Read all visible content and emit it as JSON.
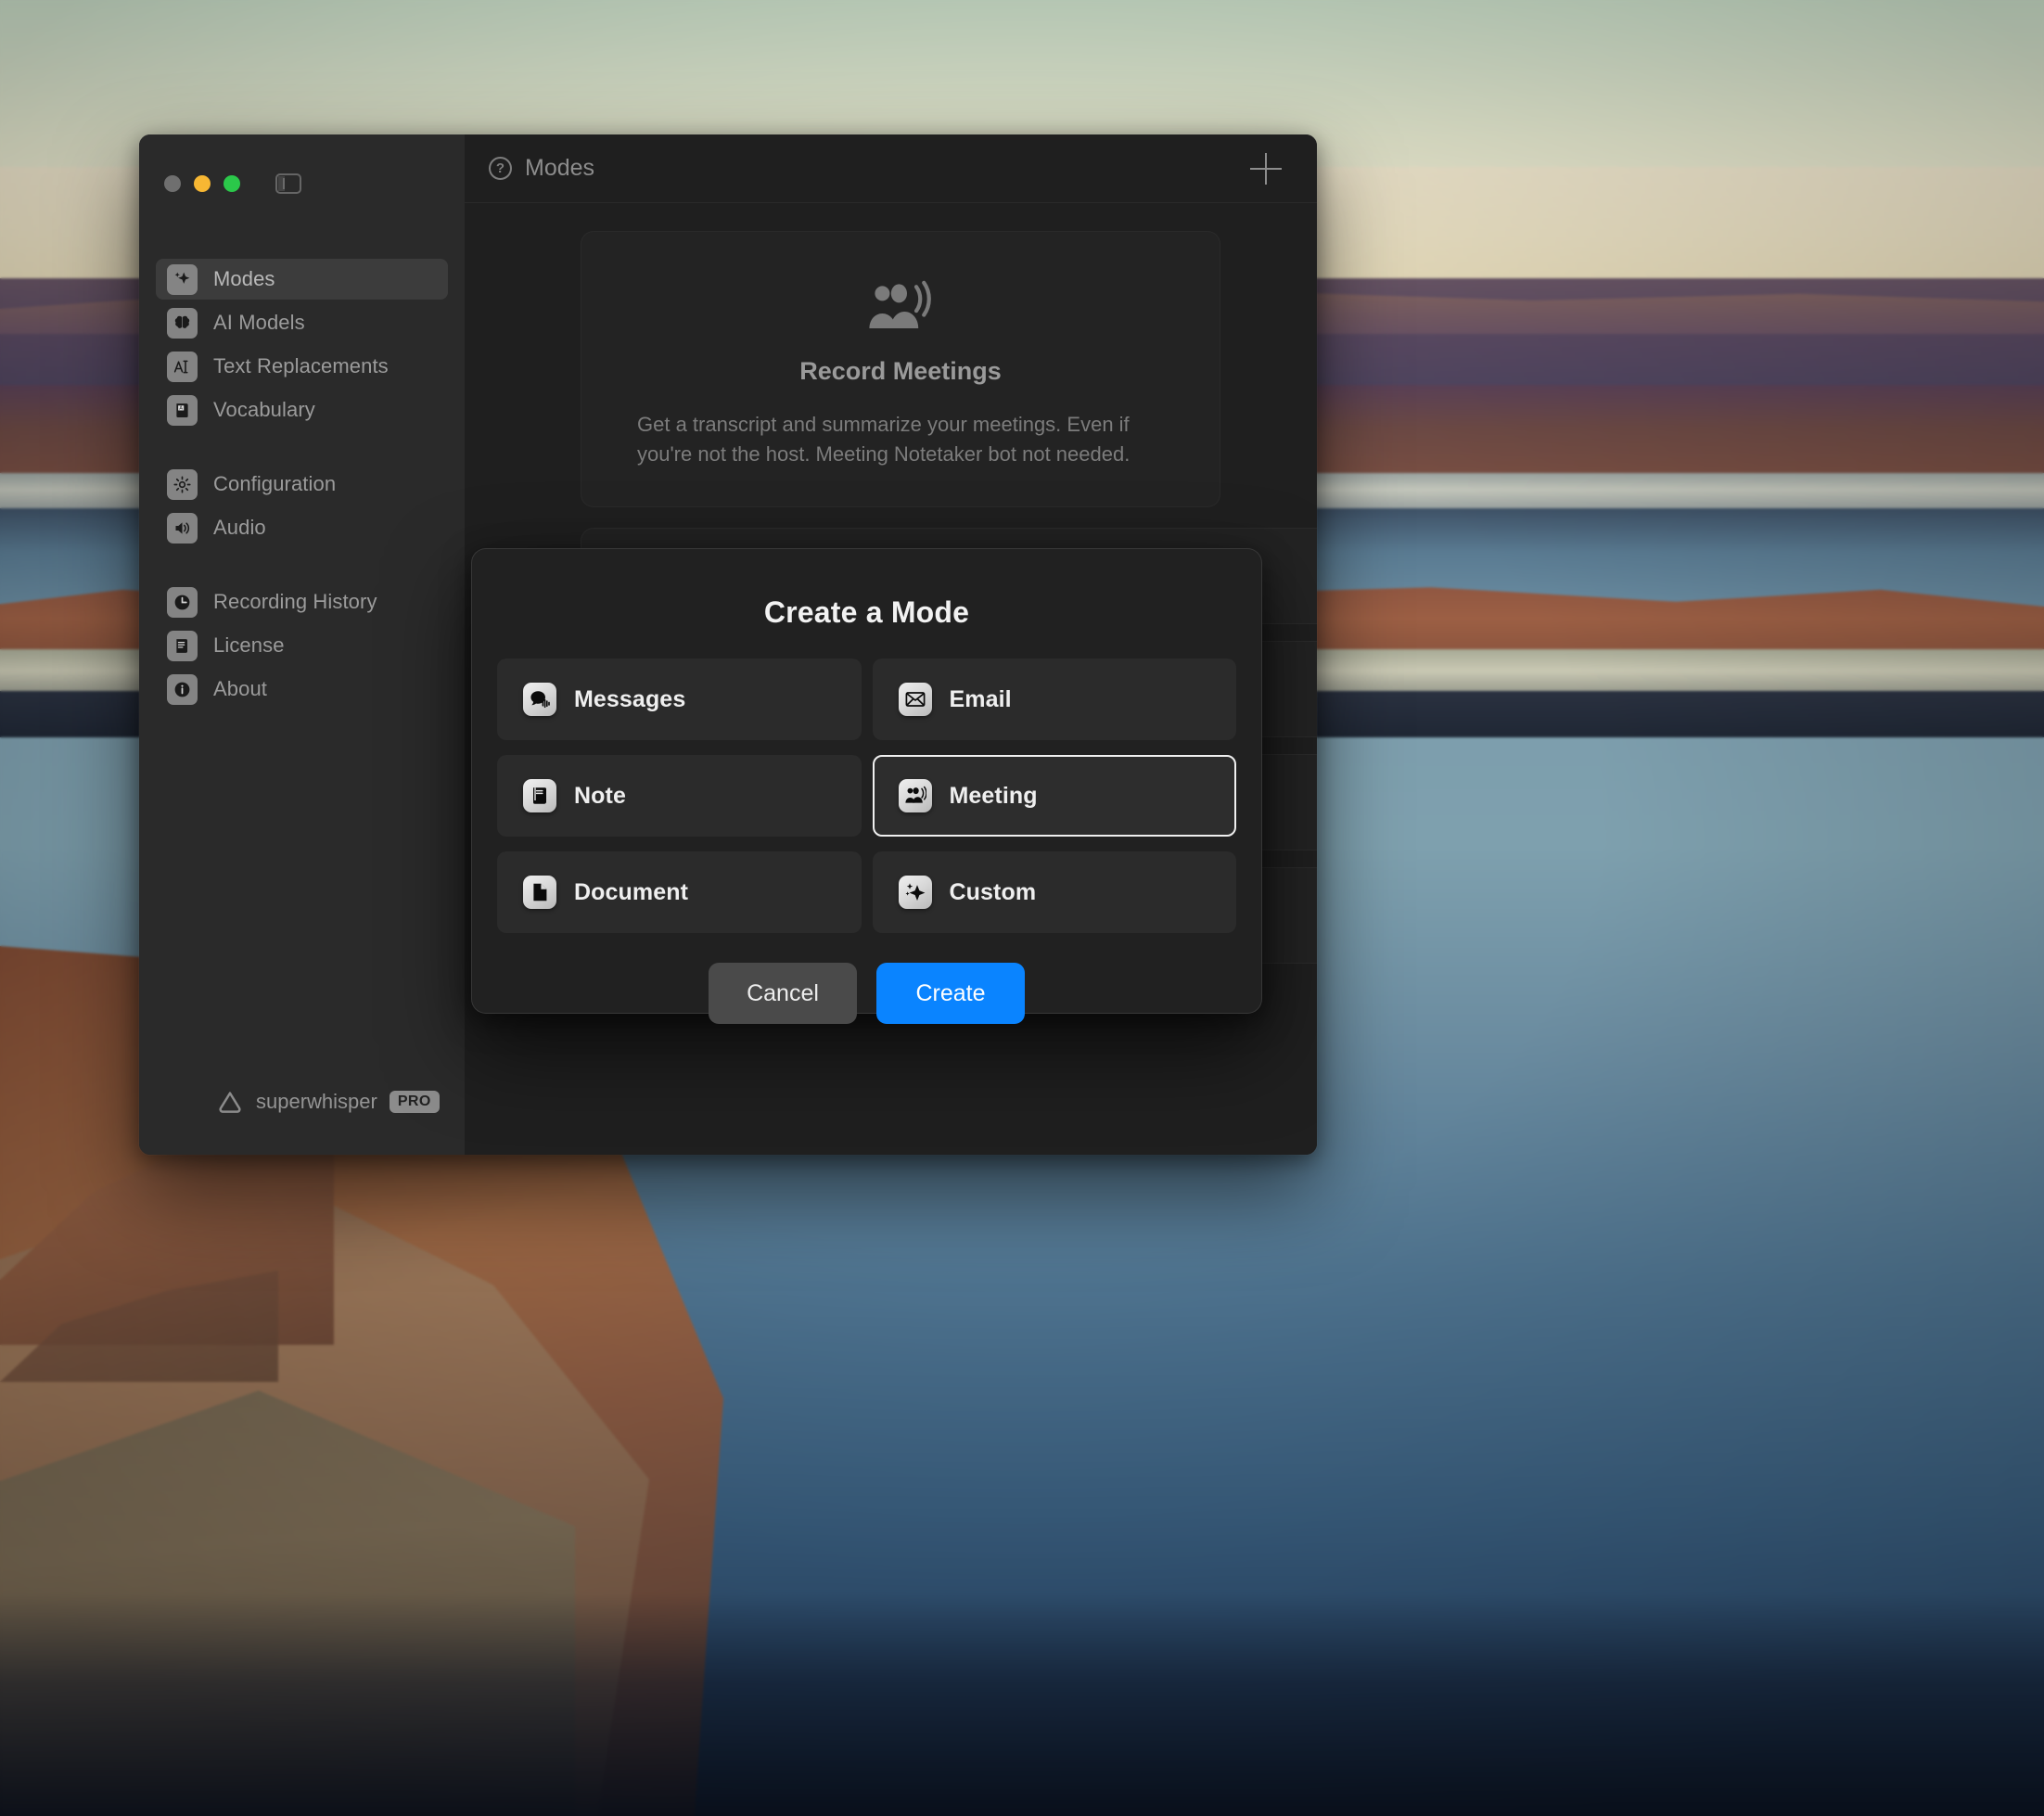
{
  "window": {
    "traffic_lights": [
      "close",
      "minimize",
      "zoom"
    ],
    "sidebar_toggle_icon": "sidebar-toggle-icon"
  },
  "sidebar": {
    "groups": [
      {
        "items": [
          {
            "label": "Modes",
            "icon": "sparkles-icon",
            "active": true
          },
          {
            "label": "AI Models",
            "icon": "brain-icon",
            "active": false
          },
          {
            "label": "Text Replacements",
            "icon": "text-cursor-icon",
            "active": false
          },
          {
            "label": "Vocabulary",
            "icon": "book-icon",
            "active": false
          }
        ]
      },
      {
        "items": [
          {
            "label": "Configuration",
            "icon": "gear-icon",
            "active": false
          },
          {
            "label": "Audio",
            "icon": "speaker-icon",
            "active": false
          }
        ]
      },
      {
        "items": [
          {
            "label": "Recording History",
            "icon": "clock-icon",
            "active": false
          },
          {
            "label": "License",
            "icon": "document-lines-icon",
            "active": false
          },
          {
            "label": "About",
            "icon": "info-icon",
            "active": false
          }
        ]
      }
    ],
    "footer": {
      "app_name": "superwhisper",
      "badge": "PRO",
      "logo_icon": "superwhisper-triangle-icon"
    }
  },
  "header": {
    "help_icon": "question-mark-icon",
    "title": "Modes",
    "add_icon": "plus-icon"
  },
  "main": {
    "promo": {
      "icon": "people-speaking-icon",
      "title": "Record Meetings",
      "description": "Get a transcript and summarize your meetings. Even if you're not the host. Meeting Notetaker bot not needed."
    },
    "mode_rows": [
      {
        "chevron": "chevron-right-icon"
      },
      {
        "chevron": "chevron-right-icon"
      },
      {
        "chevron": "chevron-right-icon"
      },
      {
        "chevron": "chevron-right-icon"
      }
    ]
  },
  "modal": {
    "title": "Create a Mode",
    "options": [
      {
        "label": "Messages",
        "icon": "speech-bubble-waveform-icon",
        "selected": false
      },
      {
        "label": "Email",
        "icon": "envelope-icon",
        "selected": false
      },
      {
        "label": "Note",
        "icon": "notebook-icon",
        "selected": false
      },
      {
        "label": "Meeting",
        "icon": "people-speaking-icon",
        "selected": true
      },
      {
        "label": "Document",
        "icon": "page-icon",
        "selected": false
      },
      {
        "label": "Custom",
        "icon": "sparkles-icon",
        "selected": false
      }
    ],
    "cancel_label": "Cancel",
    "create_label": "Create"
  },
  "colors": {
    "accent": "#0a84ff",
    "modal_bg": "#212121",
    "card_bg": "#2b2b2b",
    "sidebar_bg": "#2a2a2a",
    "content_bg": "#1f1f1f",
    "selected_border": "#f0f0f0",
    "traffic_yellow": "#f7b733",
    "traffic_green": "#2bc84a",
    "traffic_grey": "#6f6f6f"
  }
}
